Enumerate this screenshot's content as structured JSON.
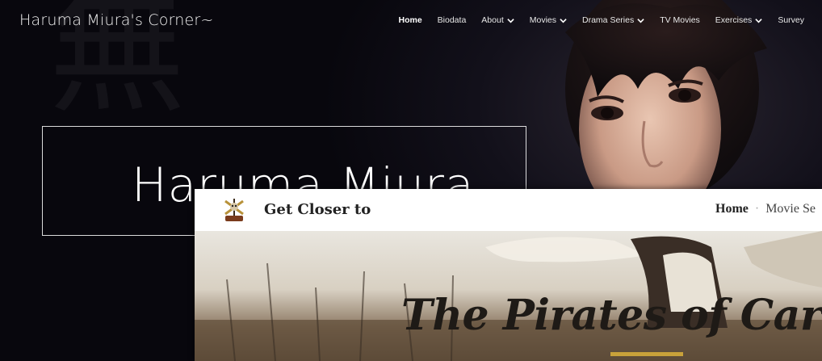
{
  "back_site": {
    "title": "Haruma Miura's Corner~",
    "nav": [
      {
        "label": "Home",
        "active": true,
        "dropdown": false
      },
      {
        "label": "Biodata",
        "active": false,
        "dropdown": false
      },
      {
        "label": "About",
        "active": false,
        "dropdown": true
      },
      {
        "label": "Movies",
        "active": false,
        "dropdown": true
      },
      {
        "label": "Drama Series",
        "active": false,
        "dropdown": true
      },
      {
        "label": "TV Movies",
        "active": false,
        "dropdown": false
      },
      {
        "label": "Exercises",
        "active": false,
        "dropdown": true
      },
      {
        "label": "Survey",
        "active": false,
        "dropdown": false
      }
    ],
    "hero_name": "Haruma Miura",
    "background_glyphs": "無",
    "colors": {
      "background": "#0b0a12",
      "text": "#ffffff"
    }
  },
  "front_site": {
    "title": "Get Closer to",
    "logo_icon": "pirate-ship-icon",
    "breadcrumb": {
      "home": "Home",
      "separator": "·",
      "current": "Movie Se"
    },
    "banner_title": "The Pirates of Caribbe",
    "colors": {
      "accent": "#c9a23a",
      "title_text": "#1e1a16"
    }
  }
}
